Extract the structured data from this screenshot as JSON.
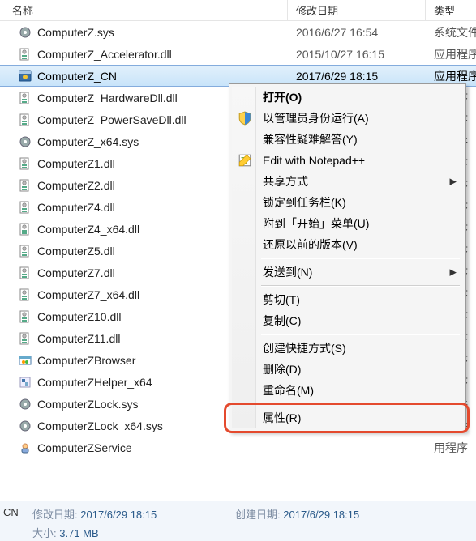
{
  "columns": {
    "name": "名称",
    "date": "修改日期",
    "type": "类型"
  },
  "files": [
    {
      "name": "ComputerZ.sys",
      "date": "2016/6/27 16:54",
      "type": "系统文件",
      "icon": "gear"
    },
    {
      "name": "ComputerZ_Accelerator.dll",
      "date": "2015/10/27 16:15",
      "type": "应用程序",
      "icon": "dll"
    },
    {
      "name": "ComputerZ_CN",
      "date": "2017/6/29 18:15",
      "type": "应用程序",
      "icon": "app",
      "selected": true
    },
    {
      "name": "ComputerZ_HardwareDll.dll",
      "date": "",
      "type": "用程序",
      "icon": "dll"
    },
    {
      "name": "ComputerZ_PowerSaveDll.dll",
      "date": "",
      "type": "用程序",
      "icon": "dll"
    },
    {
      "name": "ComputerZ_x64.sys",
      "date": "",
      "type": "充文件",
      "icon": "gear"
    },
    {
      "name": "ComputerZ1.dll",
      "date": "",
      "type": "用程序",
      "icon": "dll"
    },
    {
      "name": "ComputerZ2.dll",
      "date": "",
      "type": "用程序",
      "icon": "dll"
    },
    {
      "name": "ComputerZ4.dll",
      "date": "",
      "type": "用程序",
      "icon": "dll"
    },
    {
      "name": "ComputerZ4_x64.dll",
      "date": "",
      "type": "用程序",
      "icon": "dll"
    },
    {
      "name": "ComputerZ5.dll",
      "date": "",
      "type": "用程序",
      "icon": "dll"
    },
    {
      "name": "ComputerZ7.dll",
      "date": "",
      "type": "用程序",
      "icon": "dll"
    },
    {
      "name": "ComputerZ7_x64.dll",
      "date": "",
      "type": "用程序",
      "icon": "dll"
    },
    {
      "name": "ComputerZ10.dll",
      "date": "",
      "type": "用程序",
      "icon": "dll"
    },
    {
      "name": "ComputerZ11.dll",
      "date": "",
      "type": "用程序",
      "icon": "dll"
    },
    {
      "name": "ComputerZBrowser",
      "date": "",
      "type": "用程序",
      "icon": "browser"
    },
    {
      "name": "ComputerZHelper_x64",
      "date": "",
      "type": "用程序",
      "icon": "helper"
    },
    {
      "name": "ComputerZLock.sys",
      "date": "",
      "type": "充文件",
      "icon": "gear"
    },
    {
      "name": "ComputerZLock_x64.sys",
      "date": "",
      "type": "充文件",
      "icon": "gear"
    },
    {
      "name": "ComputerZService",
      "date": "",
      "type": "用程序",
      "icon": "service"
    }
  ],
  "context_menu": {
    "groups": [
      [
        {
          "label": "打开(O)",
          "default": true
        },
        {
          "label": "以管理员身份运行(A)",
          "icon": "shield"
        },
        {
          "label": "兼容性疑难解答(Y)"
        },
        {
          "label": "Edit with Notepad++",
          "icon": "npp"
        },
        {
          "label": "共享方式",
          "submenu": true
        },
        {
          "label": "锁定到任务栏(K)"
        },
        {
          "label": "附到「开始」菜单(U)"
        },
        {
          "label": "还原以前的版本(V)"
        }
      ],
      [
        {
          "label": "发送到(N)",
          "submenu": true
        }
      ],
      [
        {
          "label": "剪切(T)"
        },
        {
          "label": "复制(C)"
        }
      ],
      [
        {
          "label": "创建快捷方式(S)"
        },
        {
          "label": "删除(D)"
        },
        {
          "label": "重命名(M)"
        }
      ],
      [
        {
          "label": "属性(R)",
          "highlighted": true
        }
      ]
    ]
  },
  "statusbar": {
    "left": "CN",
    "mod_label": "修改日期:",
    "mod_value": "2017/6/29 18:15",
    "size_label": "大小:",
    "size_value": "3.71 MB",
    "create_label": "创建日期:",
    "create_value": "2017/6/29 18:15"
  }
}
